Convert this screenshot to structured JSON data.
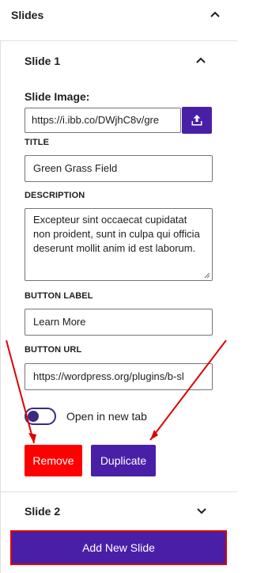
{
  "panel": {
    "title": "Slides"
  },
  "slide1": {
    "title": "Slide 1",
    "image_label": "Slide Image:",
    "image_url": "https://i.ibb.co/DWjhC8v/gre",
    "title_label": "TITLE",
    "title_value": "Green Grass Field",
    "description_label": "DESCRIPTION",
    "description_value": "Excepteur sint occaecat cupidatat non proident, sunt in culpa qui officia deserunt mollit anim id est laborum.",
    "button_label_label": "BUTTON LABEL",
    "button_label_value": "Learn More",
    "button_url_label": "BUTTON URL",
    "button_url_value": "https://wordpress.org/plugins/b-sl",
    "new_tab_label": "Open in new tab",
    "new_tab_enabled": true,
    "remove_label": "Remove",
    "duplicate_label": "Duplicate"
  },
  "slide2": {
    "title": "Slide 2"
  },
  "add_slide_label": "Add New Slide",
  "colors": {
    "accent": "#4a1fa8",
    "remove": "#ff0000",
    "annotation": "#e00000"
  },
  "icons": [
    "chevron-up-icon",
    "chevron-down-icon",
    "upload-icon",
    "resize-handle-icon"
  ]
}
